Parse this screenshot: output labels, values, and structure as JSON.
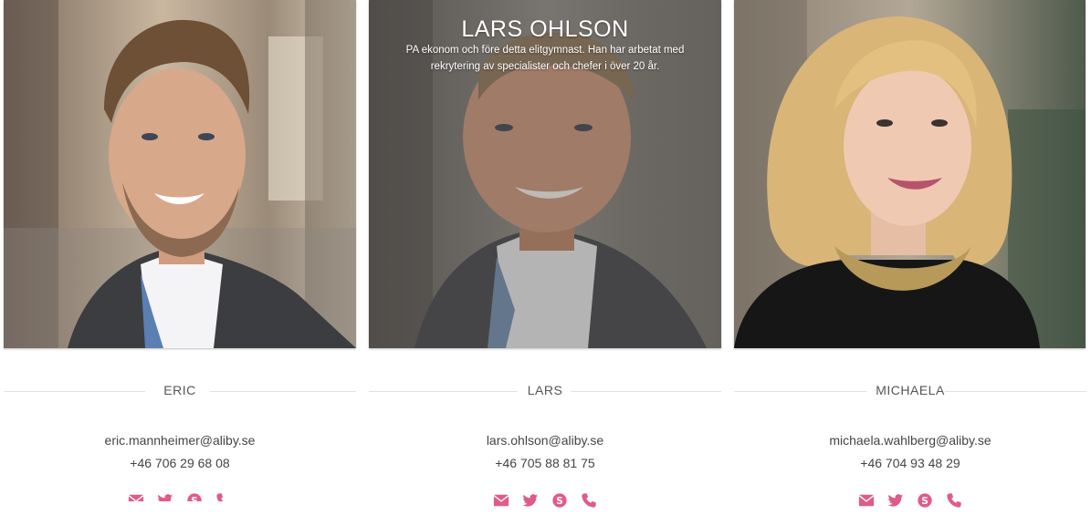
{
  "colors": {
    "accent": "#e05b86",
    "separator": "#e2e2e2",
    "text": "#444444"
  },
  "team": [
    {
      "name": "ERIC",
      "email": "eric.mannheimer@aliby.se",
      "phone": "+46 706 29 68 08",
      "icons": [
        "envelope-icon",
        "twitter-icon",
        "skype-icon",
        "phone-icon"
      ]
    },
    {
      "name": "LARS",
      "overlay_name": "LARS OHLSON",
      "overlay_bio": "PA ekonom och före detta elitgymnast. Han har arbetat med rekrytering av specialister och chefer i över 20 år.",
      "email": "lars.ohlson@aliby.se",
      "phone": "+46 705 88 81 75",
      "icons": [
        "envelope-icon",
        "twitter-icon",
        "skype-icon",
        "phone-icon"
      ]
    },
    {
      "name": "MICHAELA",
      "email": "michaela.wahlberg@aliby.se",
      "phone": "+46 704 93 48 29",
      "icons": [
        "envelope-icon",
        "twitter-icon",
        "skype-icon",
        "phone-icon"
      ]
    }
  ]
}
